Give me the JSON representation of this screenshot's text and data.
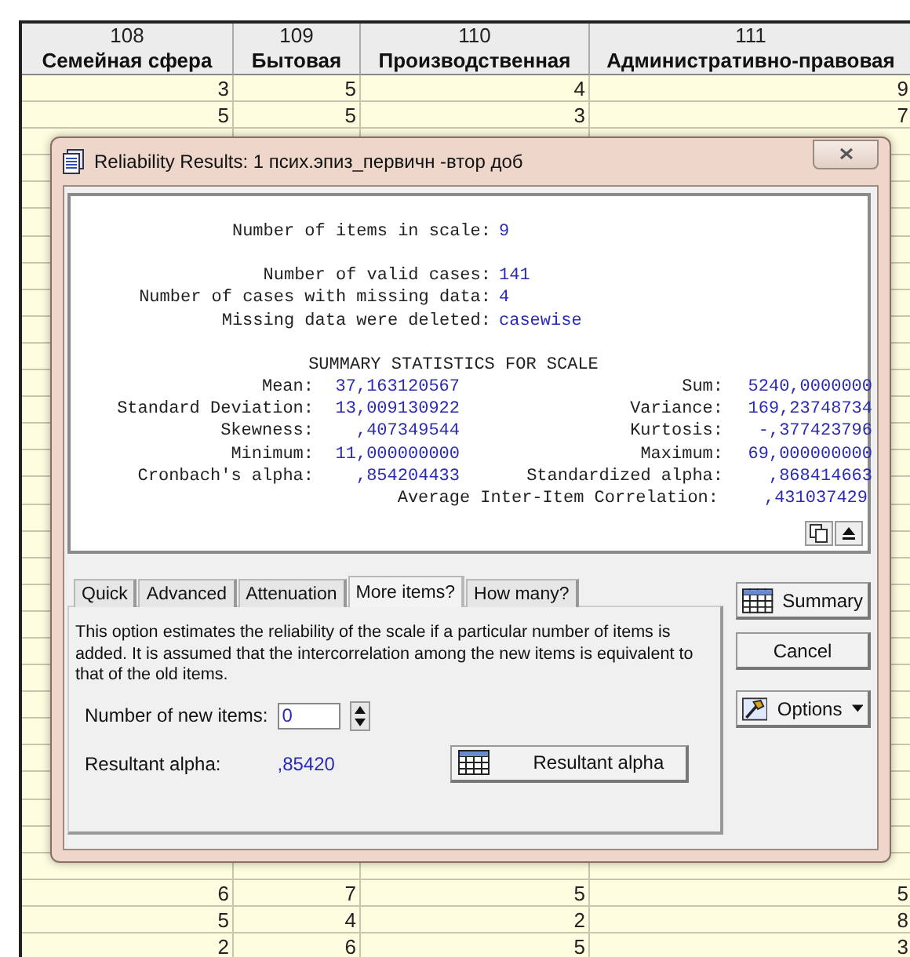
{
  "sheet": {
    "columns": [
      {
        "number": "108",
        "name": "Семейная сфера"
      },
      {
        "number": "109",
        "name": "Бытовая"
      },
      {
        "number": "110",
        "name": "Производственная"
      },
      {
        "number": "111",
        "name": "Административно-правовая"
      }
    ],
    "top_rows": [
      [
        "3",
        "5",
        "4",
        "9"
      ],
      [
        "5",
        "5",
        "3",
        "7"
      ]
    ],
    "bottom_rows": [
      [
        "6",
        "7",
        "5",
        "5"
      ],
      [
        "5",
        "4",
        "2",
        "8"
      ],
      [
        "2",
        "6",
        "5",
        "3"
      ]
    ]
  },
  "dialog": {
    "title": "Reliability Results: 1 псих.эпиз_первичн -втор доб",
    "output": {
      "items": [
        {
          "label": "Number of items in scale:",
          "value": "9"
        }
      ],
      "cases": [
        {
          "label": "Number of valid cases:",
          "value": "141"
        },
        {
          "label": "Number of cases with missing data:",
          "value": "4"
        },
        {
          "label": "Missing data were deleted:",
          "value": "casewise"
        }
      ],
      "summary_title": "SUMMARY STATISTICS FOR SCALE",
      "stats": [
        {
          "left_label": "Mean:",
          "left_value": "37,163120567",
          "right_label": "Sum:",
          "right_value": "5240,0000000"
        },
        {
          "left_label": "Standard Deviation:",
          "left_value": "13,009130922",
          "right_label": "Variance:",
          "right_value": "169,23748734"
        },
        {
          "left_label": "Skewness:",
          "left_value": ",407349544",
          "right_label": "Kurtosis:",
          "right_value": "-,377423796"
        },
        {
          "left_label": "Minimum:",
          "left_value": "11,000000000",
          "right_label": "Maximum:",
          "right_value": "69,000000000"
        },
        {
          "left_label": "Cronbach's alpha:",
          "left_value": ",854204433",
          "right_label": "Standardized alpha:",
          "right_value": ",868414663"
        }
      ],
      "last": {
        "label": "Average Inter-Item Correlation:",
        "value": ",431037429"
      }
    },
    "tabs": [
      {
        "label": "Quick",
        "selected": false
      },
      {
        "label": "Advanced",
        "selected": false
      },
      {
        "label": "Attenuation",
        "selected": false
      },
      {
        "label": "More items?",
        "selected": true
      },
      {
        "label": "How many?",
        "selected": false
      }
    ],
    "description": "This option estimates the reliability of the scale if a particular number of items is added.  It is assumed that the intercorrelation among the new items is equivalent to that of the old items.",
    "new_items": {
      "label": "Number of new items:",
      "value": "0"
    },
    "resultant": {
      "label": "Resultant alpha:",
      "value": ",85420",
      "button": "Resultant alpha"
    },
    "buttons": {
      "summary": "Summary",
      "cancel": "Cancel",
      "options": "Options"
    }
  }
}
